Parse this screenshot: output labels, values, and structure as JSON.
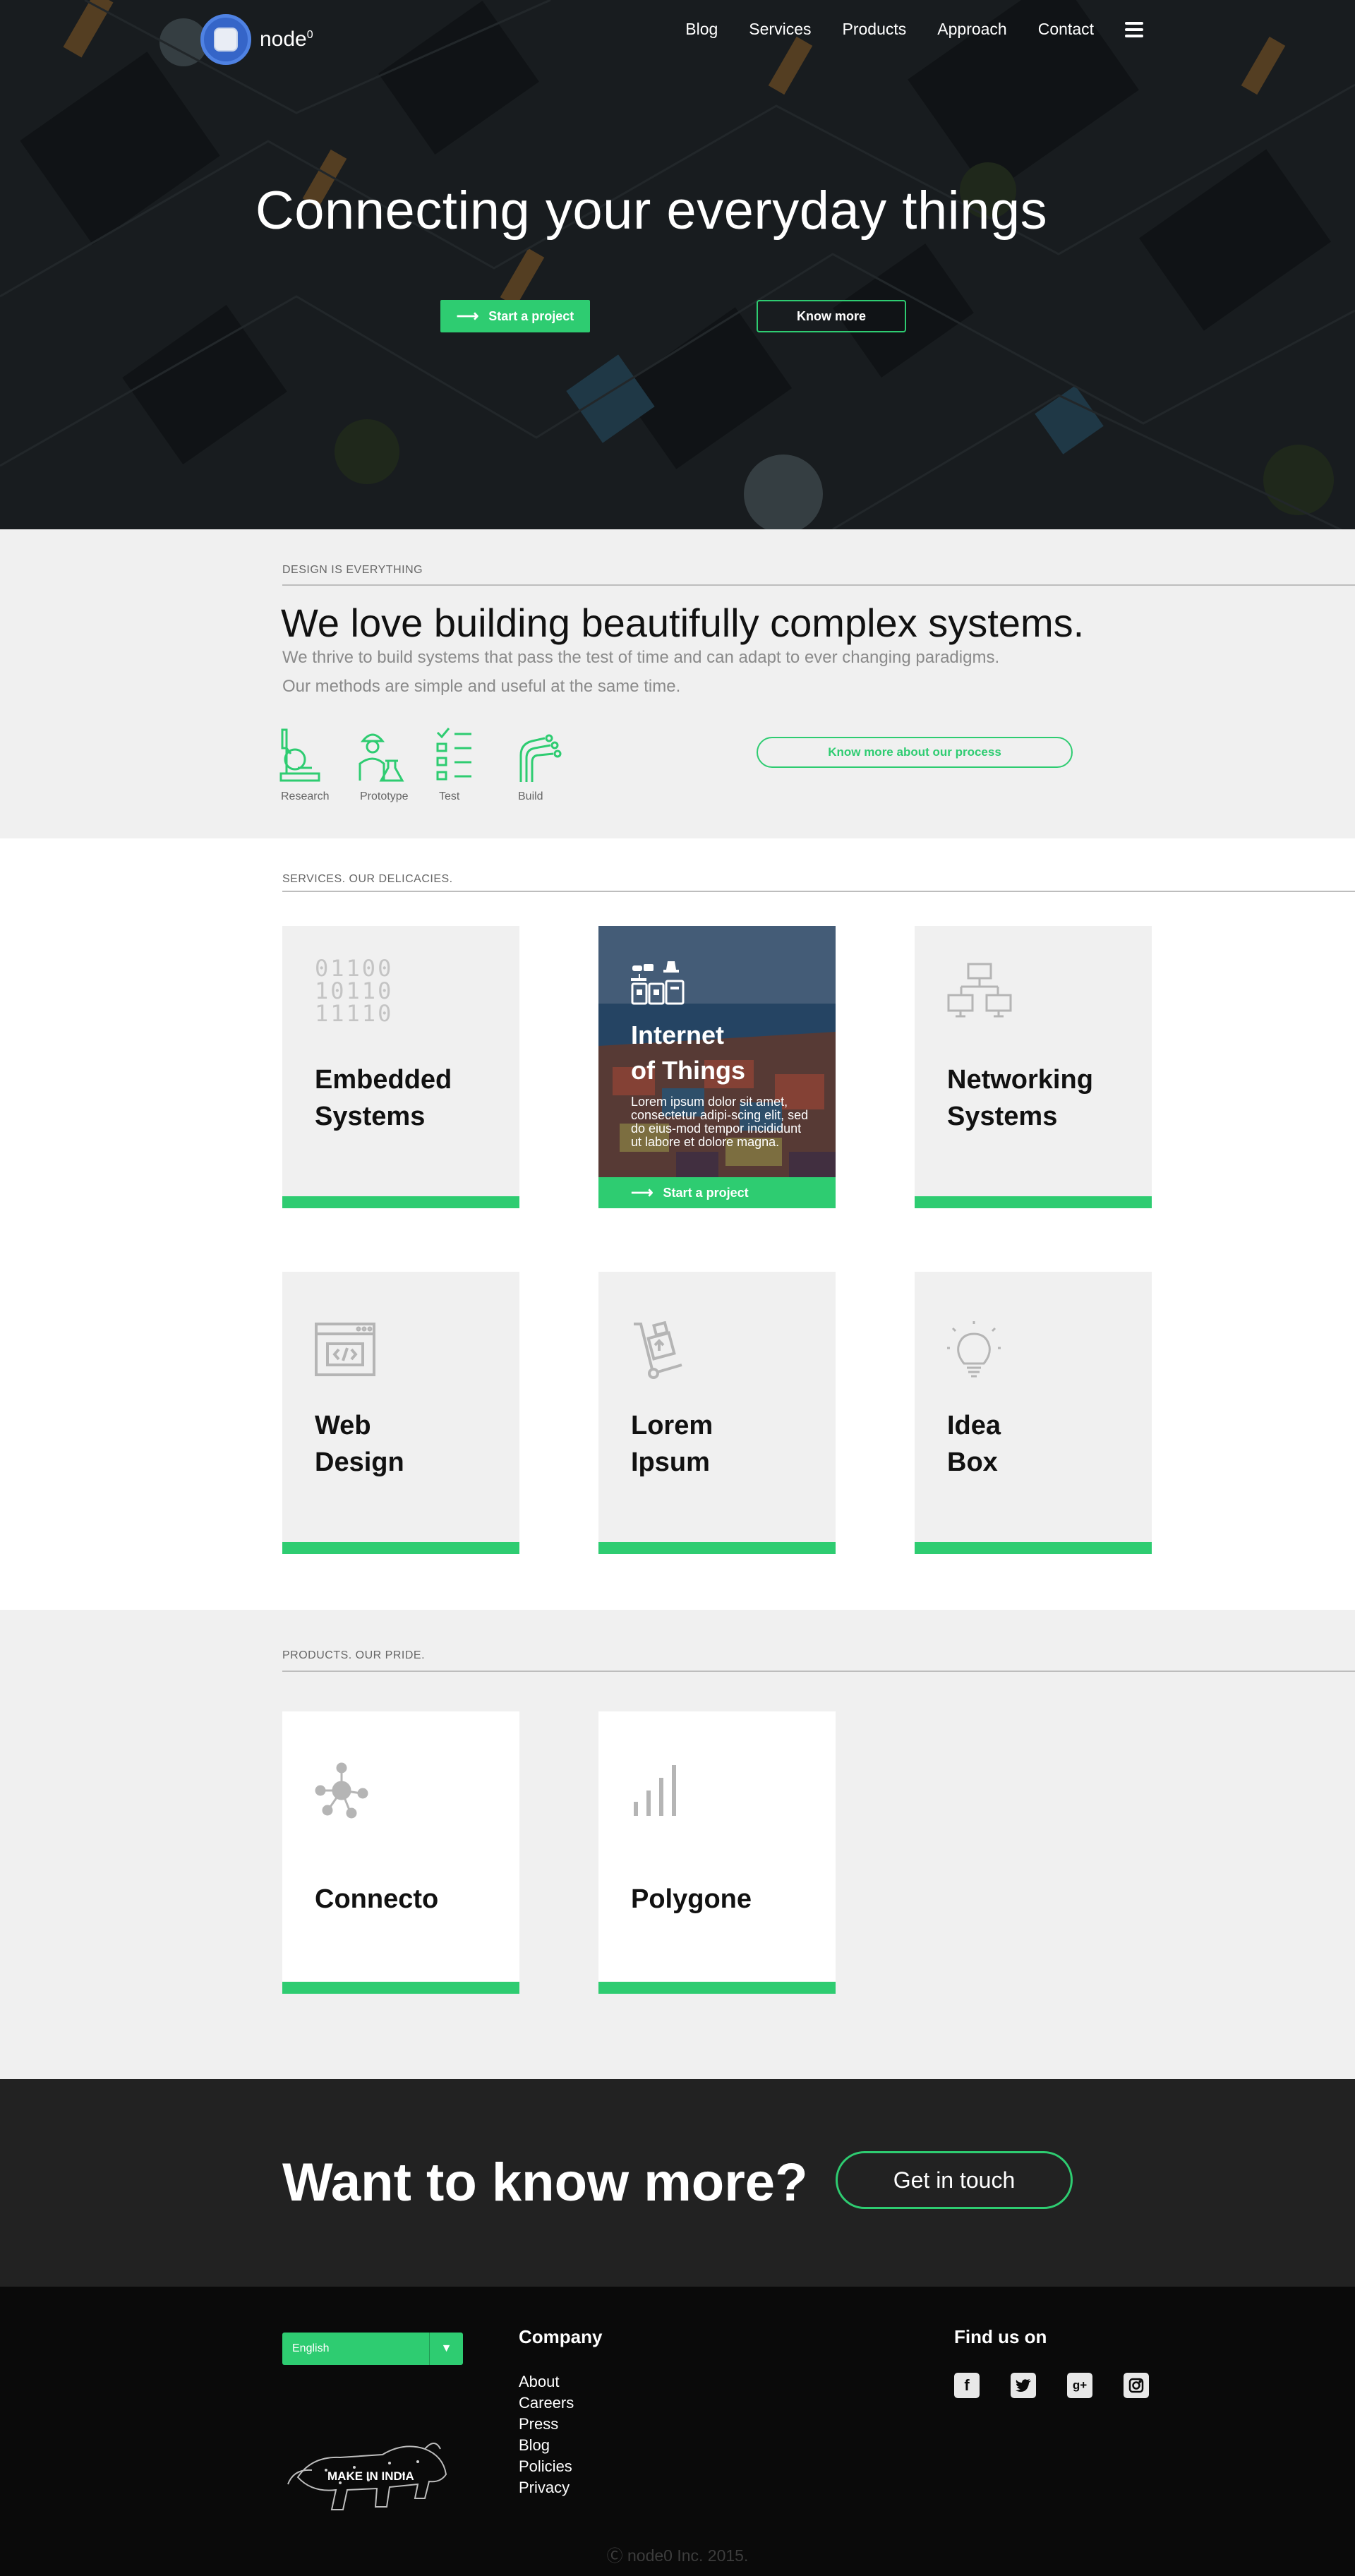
{
  "nav": {
    "brand": "node",
    "brand_sup": "0",
    "links": [
      "Blog",
      "Services",
      "Products",
      "Approach",
      "Contact"
    ]
  },
  "hero": {
    "title": "Connecting your everyday things",
    "primary_button": "Start a project",
    "secondary_button": "Know more"
  },
  "design": {
    "label": "DESIGN IS EVERYTHING",
    "heading": "We love building beautifully complex systems.",
    "line1": "We thrive to build systems that pass the test of time and can adapt to ever changing paradigms.",
    "line2": "Our methods are simple and useful at the same time.",
    "steps": [
      {
        "label": "Research",
        "icon": "microscope-icon"
      },
      {
        "label": "Prototype",
        "icon": "engineer-flask-icon"
      },
      {
        "label": "Test",
        "icon": "checklist-icon"
      },
      {
        "label": "Build",
        "icon": "circuit-hand-icon"
      }
    ],
    "process_button": "Know more about our process",
    "accent_color": "#2ecc71"
  },
  "services": {
    "label": "SERVICES. OUR DELICACIES.",
    "embedded": {
      "binary": [
        "01100",
        "10110",
        "11110"
      ],
      "title1": "Embedded",
      "title2": "Systems"
    },
    "iot": {
      "title1": "Internet",
      "title2": "of Things",
      "text": "Lorem ipsum dolor sit amet, consectetur adipi-scing elit, sed do eius-mod tempor incididunt ut labore et dolore magna.",
      "button": "Start a project"
    },
    "networking": {
      "title1": "Networking",
      "title2": "Systems",
      "icon": "network-icon"
    },
    "web": {
      "title1": "Web",
      "title2": "Design",
      "icon": "code-window-icon"
    },
    "lorem": {
      "title1": "Lorem",
      "title2": "Ipsum",
      "icon": "hand-truck-icon"
    },
    "idea": {
      "title1": "Idea",
      "title2": "Box",
      "icon": "lightbulb-icon"
    }
  },
  "products": {
    "label": "PRODUCTS. OUR PRIDE.",
    "items": [
      {
        "title": "Connecto",
        "icon": "hub-icon"
      },
      {
        "title": "Polygone",
        "icon": "signal-bars-icon"
      }
    ]
  },
  "cta": {
    "heading": "Want to know more?",
    "button": "Get in touch"
  },
  "footer": {
    "language": "English",
    "badge": "MAKE IN INDIA",
    "company_heading": "Company",
    "company_links": [
      "About",
      "Careers",
      "Press",
      "Blog",
      "Policies",
      "Privacy"
    ],
    "social_heading": "Find us on",
    "socials": [
      "facebook-icon",
      "twitter-icon",
      "google-plus-icon",
      "instagram-icon"
    ],
    "copyright": "Ⓒ node0 Inc. 2015."
  }
}
